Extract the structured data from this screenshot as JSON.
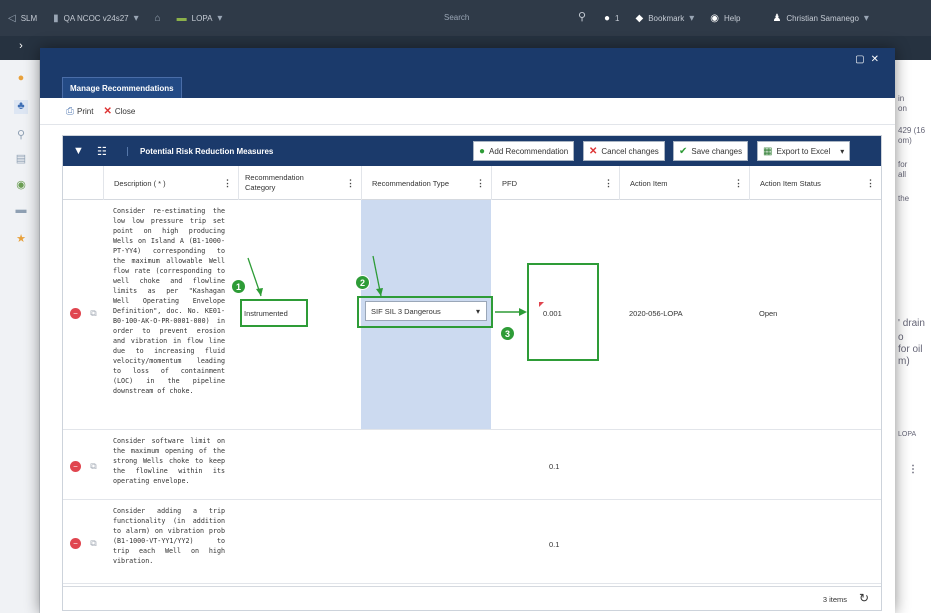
{
  "topbar": {
    "app": "SLM",
    "project": "QA NCOC v24s27",
    "module": "LOPA",
    "search_placeholder": "Search",
    "notif_count": "1",
    "bookmark": "Bookmark",
    "help": "Help",
    "user": "Christian Samanego"
  },
  "modal": {
    "tab": "Manage Recommendations",
    "print": "Print",
    "close": "Close"
  },
  "grid": {
    "title": "Potential Risk Reduction Measures",
    "buttons": {
      "add": "Add Recommendation",
      "cancel": "Cancel changes",
      "save": "Save changes",
      "export": "Export to Excel"
    },
    "columns": {
      "description": "Description ( * )",
      "category": "Recommendation Category",
      "type": "Recommendation Type",
      "pfd": "PFD",
      "action_item": "Action Item",
      "status": "Action Item Status"
    },
    "rows": [
      {
        "description": "Consider re-estimating the low low pressure trip set point on high producing Wells on Island A (B1-1000-PT-YY4) corresponding to the maximum allowable Well flow rate (corresponding to well choke and flowline limits as per \"Kashagan Well Operating Envelope Definition\", doc. No. KE01-B0-100-AK-O-PR-0001-000) in order to prevent erosion and vibration in flow line due to increasing fluid velocity/momentum leading to loss of containment (LOC) in the pipeline downstream of choke.",
        "category": "Instrumented",
        "type": "SIF SIL 3 Dangerous",
        "pfd": "0.001",
        "action_item": "2020-056-LOPA",
        "status": "Open"
      },
      {
        "description": "Consider software limit on the maximum opening of the strong Wells choke to keep the flowline within its operating envelope.",
        "category": "",
        "type": "",
        "pfd": "0.1",
        "action_item": "",
        "status": ""
      },
      {
        "description": "Consider adding a trip functionality (in addition to alarm) on vibration prob (B1-1000-VT-YY1/YY2) to trip each Well on high vibration.",
        "category": "",
        "type": "",
        "pfd": "0.1",
        "action_item": "",
        "status": ""
      }
    ],
    "footer_count": "3 items"
  },
  "annotations": [
    "1",
    "2",
    "3"
  ],
  "background_right": [
    "in",
    "on",
    "429 (16",
    "om)",
    "for",
    "all",
    "the",
    "' drain",
    "o",
    "for oil",
    "m)",
    "LOPA"
  ]
}
